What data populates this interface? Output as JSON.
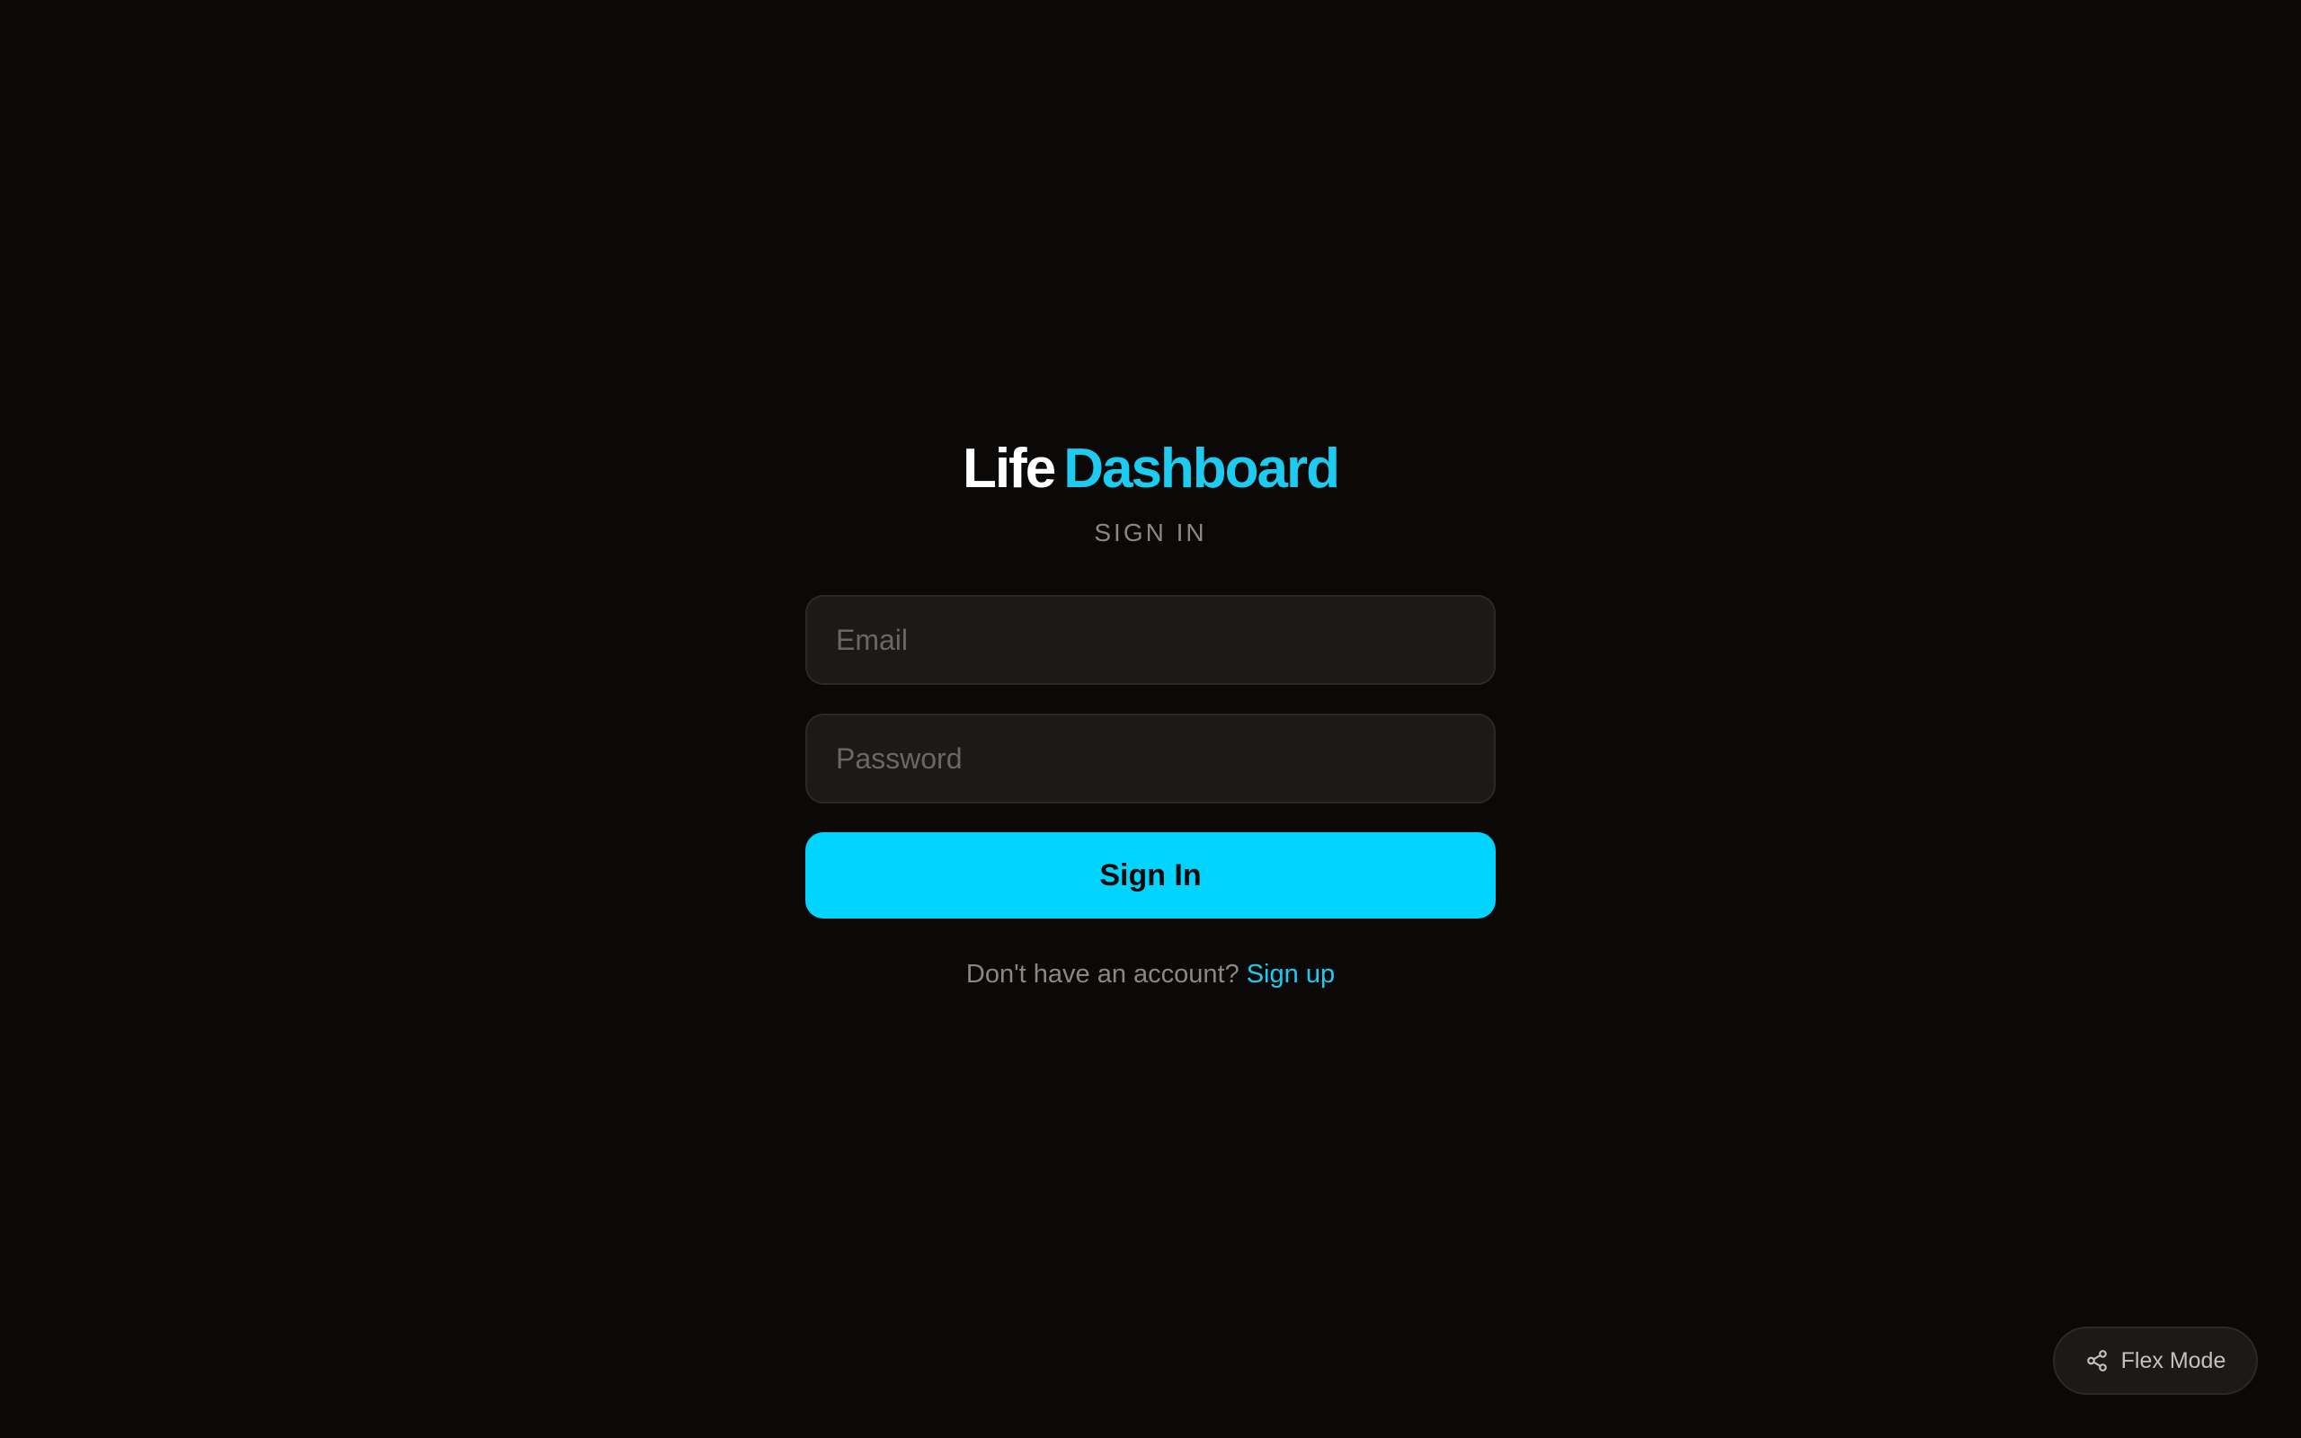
{
  "brand": {
    "word1": "Life",
    "word2": "Dashboard",
    "accent_color": "#1ecbf0"
  },
  "form": {
    "subtitle": "SIGN IN",
    "email": {
      "value": "",
      "placeholder": "Email"
    },
    "password": {
      "value": "",
      "placeholder": "Password"
    },
    "submit_label": "Sign In",
    "submit_color": "#00d4ff"
  },
  "footer": {
    "prompt": "Don't have an account?",
    "link_label": "Sign up"
  },
  "flex_mode": {
    "icon": "share-icon",
    "label": "Flex Mode"
  }
}
